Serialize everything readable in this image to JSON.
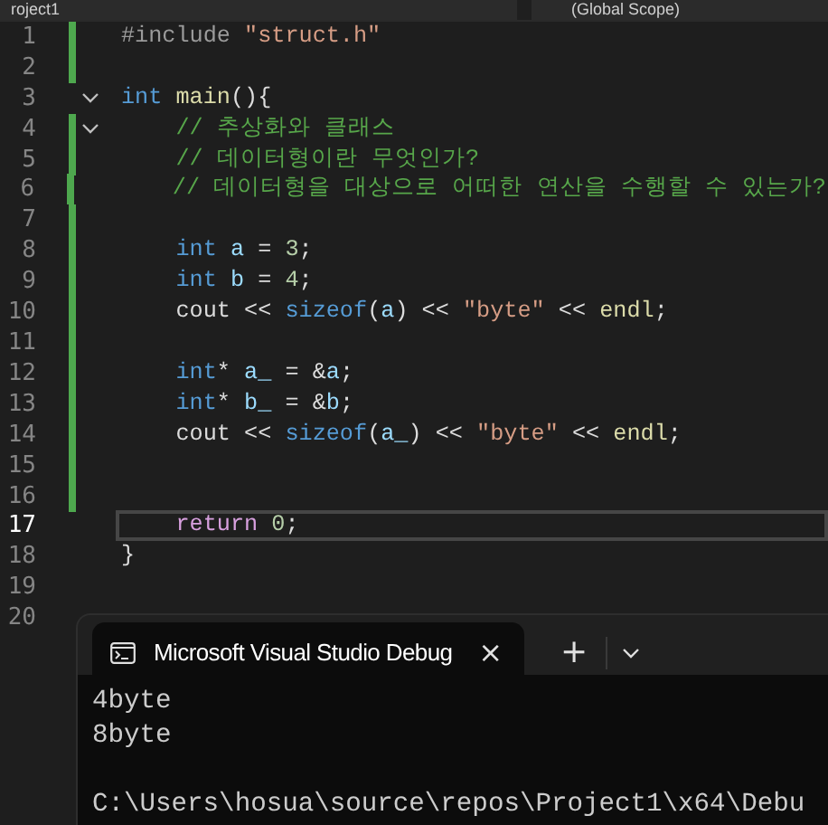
{
  "navigation_bar": {
    "project_dropdown": "roject1",
    "scope_dropdown": "(Global Scope)"
  },
  "editor": {
    "lines": [
      {
        "number": "1",
        "changed": true,
        "fold": false,
        "current": false,
        "tokens": [
          {
            "kind": "preprocessor",
            "text": "#include "
          },
          {
            "kind": "string",
            "text": "\"struct.h\""
          }
        ]
      },
      {
        "number": "2",
        "changed": true,
        "fold": false,
        "current": false
      },
      {
        "number": "3",
        "changed": false,
        "fold": true,
        "current": false,
        "tokens": [
          {
            "kind": "keyword",
            "text": "int "
          },
          {
            "kind": "function",
            "text": "main"
          },
          {
            "kind": "plain",
            "text": "(){"
          }
        ]
      },
      {
        "number": "4",
        "changed": true,
        "fold": true,
        "current": false,
        "tokens": [
          {
            "kind": "comment",
            "text": "    // 추상화와 클래스"
          }
        ]
      },
      {
        "number": "5",
        "changed": true,
        "fold": false,
        "current": false,
        "tokens": [
          {
            "kind": "comment",
            "text": "    // 데이터형이란 무엇인가?"
          }
        ]
      },
      {
        "number": "6",
        "changed": true,
        "fold": false,
        "current": false,
        "tokens": [
          {
            "kind": "comment",
            "text": "    // 데이터형을 대상으로 어떠한 연산을 수행할 수 있는가?"
          }
        ]
      },
      {
        "number": "7",
        "changed": true,
        "fold": false,
        "current": false
      },
      {
        "number": "8",
        "changed": true,
        "fold": false,
        "current": false,
        "tokens": [
          {
            "kind": "keyword",
            "text": "    int "
          },
          {
            "kind": "variable",
            "text": "a"
          },
          {
            "kind": "plain",
            "text": " = "
          },
          {
            "kind": "number",
            "text": "3"
          },
          {
            "kind": "plain",
            "text": ";"
          }
        ]
      },
      {
        "number": "9",
        "changed": true,
        "fold": false,
        "current": false,
        "tokens": [
          {
            "kind": "keyword",
            "text": "    int "
          },
          {
            "kind": "variable",
            "text": "b"
          },
          {
            "kind": "plain",
            "text": " = "
          },
          {
            "kind": "number",
            "text": "4"
          },
          {
            "kind": "plain",
            "text": ";"
          }
        ]
      },
      {
        "number": "10",
        "changed": true,
        "fold": false,
        "current": false,
        "tokens": [
          {
            "kind": "plain",
            "text": "    cout << "
          },
          {
            "kind": "keyword",
            "text": "sizeof"
          },
          {
            "kind": "plain",
            "text": "("
          },
          {
            "kind": "variable",
            "text": "a"
          },
          {
            "kind": "plain",
            "text": ") << "
          },
          {
            "kind": "string",
            "text": "\"byte\""
          },
          {
            "kind": "plain",
            "text": " << "
          },
          {
            "kind": "function",
            "text": "endl"
          },
          {
            "kind": "plain",
            "text": ";"
          }
        ]
      },
      {
        "number": "11",
        "changed": true,
        "fold": false,
        "current": false
      },
      {
        "number": "12",
        "changed": true,
        "fold": false,
        "current": false,
        "tokens": [
          {
            "kind": "keyword",
            "text": "    int"
          },
          {
            "kind": "plain",
            "text": "* "
          },
          {
            "kind": "variable",
            "text": "a_"
          },
          {
            "kind": "plain",
            "text": " = &"
          },
          {
            "kind": "variable",
            "text": "a"
          },
          {
            "kind": "plain",
            "text": ";"
          }
        ]
      },
      {
        "number": "13",
        "changed": true,
        "fold": false,
        "current": false,
        "tokens": [
          {
            "kind": "keyword",
            "text": "    int"
          },
          {
            "kind": "plain",
            "text": "* "
          },
          {
            "kind": "variable",
            "text": "b_"
          },
          {
            "kind": "plain",
            "text": " = &"
          },
          {
            "kind": "variable",
            "text": "b"
          },
          {
            "kind": "plain",
            "text": ";"
          }
        ]
      },
      {
        "number": "14",
        "changed": true,
        "fold": false,
        "current": false,
        "tokens": [
          {
            "kind": "plain",
            "text": "    cout << "
          },
          {
            "kind": "keyword",
            "text": "sizeof"
          },
          {
            "kind": "plain",
            "text": "("
          },
          {
            "kind": "variable",
            "text": "a_"
          },
          {
            "kind": "plain",
            "text": ") << "
          },
          {
            "kind": "string",
            "text": "\"byte\""
          },
          {
            "kind": "plain",
            "text": " << "
          },
          {
            "kind": "function",
            "text": "endl"
          },
          {
            "kind": "plain",
            "text": ";"
          }
        ]
      },
      {
        "number": "15",
        "changed": true,
        "fold": false,
        "current": false
      },
      {
        "number": "16",
        "changed": true,
        "fold": false,
        "current": false
      },
      {
        "number": "17",
        "changed": false,
        "fold": false,
        "current": true,
        "tokens": [
          {
            "kind": "control",
            "text": "    return "
          },
          {
            "kind": "number",
            "text": "0"
          },
          {
            "kind": "plain",
            "text": ";"
          }
        ]
      },
      {
        "number": "18",
        "changed": false,
        "fold": false,
        "current": false,
        "tokens": [
          {
            "kind": "plain",
            "text": "}"
          }
        ]
      },
      {
        "number": "19",
        "changed": false,
        "fold": false,
        "current": false
      },
      {
        "number": "20",
        "changed": false,
        "fold": false,
        "current": false
      }
    ]
  },
  "terminal": {
    "tab_title": "Microsoft Visual Studio Debug",
    "close": "×",
    "new_tab": "+",
    "output": [
      "4byte",
      "8byte"
    ],
    "prompt": "C:\\Users\\hosua\\source\\repos\\Project1\\x64\\Debu"
  }
}
